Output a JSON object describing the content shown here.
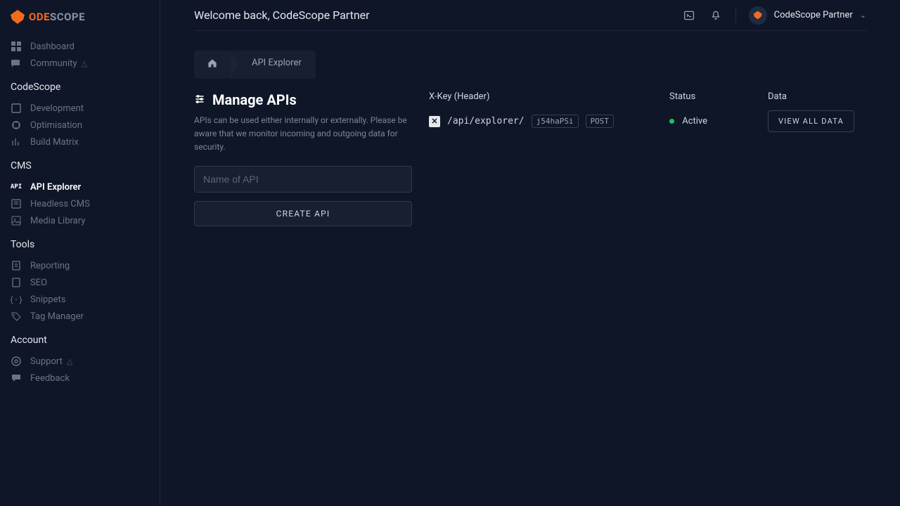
{
  "brand": {
    "first": "ODE",
    "second": "SCOPE"
  },
  "header": {
    "welcome": "Welcome back, CodeScope Partner",
    "username": "CodeScope Partner"
  },
  "breadcrumb": {
    "current": "API Explorer"
  },
  "sidebar": {
    "top": [
      {
        "label": "Dashboard"
      },
      {
        "label": "Community",
        "wait": "△"
      }
    ],
    "sections": [
      {
        "title": "CodeScope",
        "items": [
          {
            "label": "Development"
          },
          {
            "label": "Optimisation"
          },
          {
            "label": "Build Matrix"
          }
        ]
      },
      {
        "title": "CMS",
        "items": [
          {
            "label": "API Explorer",
            "active": true
          },
          {
            "label": "Headless CMS"
          },
          {
            "label": "Media Library"
          }
        ]
      },
      {
        "title": "Tools",
        "items": [
          {
            "label": "Reporting"
          },
          {
            "label": "SEO"
          },
          {
            "label": "Snippets"
          },
          {
            "label": "Tag Manager"
          }
        ]
      },
      {
        "title": "Account",
        "items": [
          {
            "label": "Support",
            "wait": "△"
          },
          {
            "label": "Feedback"
          }
        ]
      }
    ]
  },
  "page": {
    "title": "Manage APIs",
    "description": "APIs can be used either internally or externally. Please be aware that we monitor incoming and outgoing data for security.",
    "input_placeholder": "Name of API",
    "create_label": "CREATE API"
  },
  "table": {
    "headers": {
      "key": "X-Key (Header)",
      "status": "Status",
      "data": "Data"
    },
    "rows": [
      {
        "endpoint": "/api/explorer/",
        "key": "j54haPSi",
        "method": "POST",
        "status": "Active",
        "action": "VIEW ALL DATA"
      }
    ]
  }
}
